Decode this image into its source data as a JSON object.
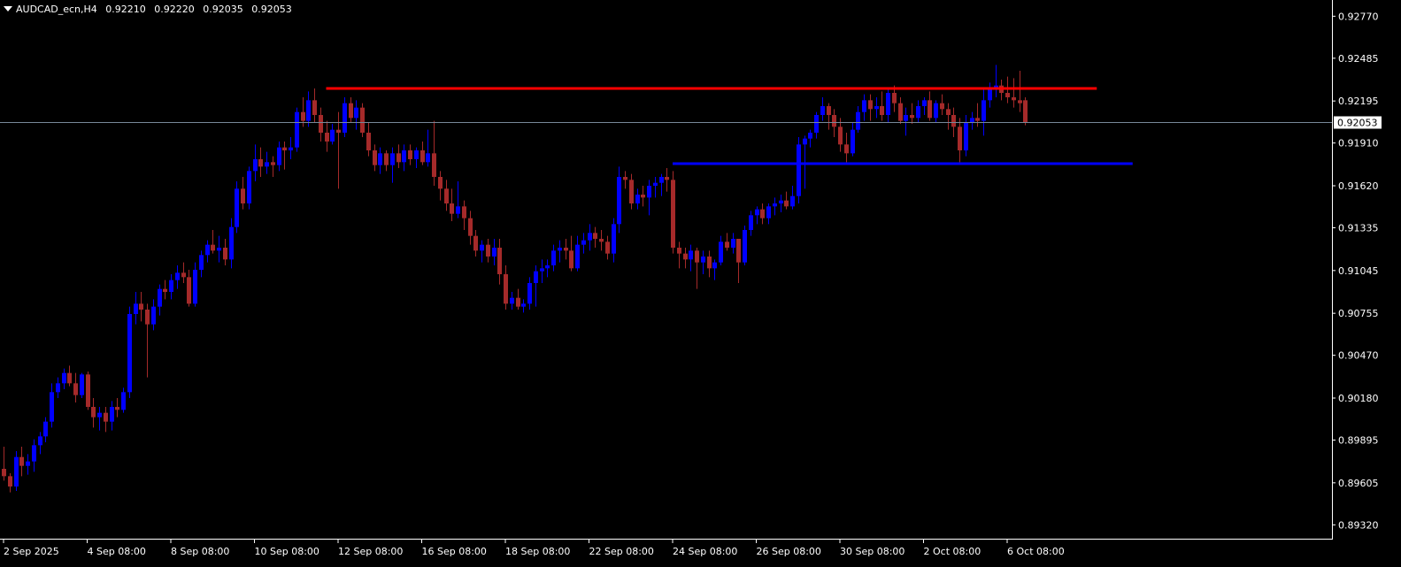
{
  "header": {
    "symbol_tf": "AUDCAD_ecn,H4",
    "ohlc": [
      "0.92210",
      "0.92220",
      "0.92035",
      "0.92053"
    ]
  },
  "colors": {
    "background": "#000000",
    "bull": "#0000ff",
    "bear": "#a52a2a",
    "resistance": "#ff0000",
    "support": "#0000ff",
    "bid_line": "#778899",
    "axis": "#ffffff"
  },
  "chart_data": {
    "type": "candlestick",
    "symbol": "AUDCAD_ecn",
    "timeframe": "H4",
    "ylim": [
      0.8922,
      0.9288
    ],
    "y_ticks": [
      "0.92770",
      "0.92485",
      "0.92195",
      "0.91910",
      "0.91620",
      "0.91335",
      "0.91045",
      "0.90755",
      "0.90470",
      "0.90180",
      "0.89895",
      "0.89605",
      "0.89320"
    ],
    "x_ticks": [
      {
        "label": "2 Sep 2025",
        "bar": 0
      },
      {
        "label": "4 Sep 08:00",
        "bar": 14
      },
      {
        "label": "8 Sep 08:00",
        "bar": 28
      },
      {
        "label": "10 Sep 08:00",
        "bar": 42
      },
      {
        "label": "12 Sep 08:00",
        "bar": 56
      },
      {
        "label": "16 Sep 08:00",
        "bar": 70
      },
      {
        "label": "18 Sep 08:00",
        "bar": 84
      },
      {
        "label": "22 Sep 08:00",
        "bar": 98
      },
      {
        "label": "24 Sep 08:00",
        "bar": 112
      },
      {
        "label": "26 Sep 08:00",
        "bar": 126
      },
      {
        "label": "30 Sep 08:00",
        "bar": 140
      },
      {
        "label": "2 Oct 08:00",
        "bar": 154
      },
      {
        "label": "6 Oct 08:00",
        "bar": 168
      }
    ],
    "current_price": "0.92053",
    "current_price_value": 0.92053,
    "levels": [
      {
        "kind": "resistance",
        "price": 0.9228,
        "from_bar": 54,
        "to_bar": 183
      },
      {
        "kind": "support",
        "price": 0.9177,
        "from_bar": 112,
        "to_bar": 189
      }
    ],
    "candles": [
      [
        0.897,
        0.8985,
        0.8962,
        0.8965
      ],
      [
        0.8965,
        0.8967,
        0.8954,
        0.8958
      ],
      [
        0.8958,
        0.8982,
        0.8955,
        0.8978
      ],
      [
        0.8978,
        0.8985,
        0.8965,
        0.8972
      ],
      [
        0.8972,
        0.898,
        0.8966,
        0.8975
      ],
      [
        0.8975,
        0.899,
        0.8968,
        0.8986
      ],
      [
        0.8986,
        0.8995,
        0.898,
        0.8992
      ],
      [
        0.8992,
        0.9005,
        0.8988,
        0.9002
      ],
      [
        0.9002,
        0.9028,
        0.8998,
        0.9022
      ],
      [
        0.9022,
        0.9032,
        0.9018,
        0.9028
      ],
      [
        0.9028,
        0.9038,
        0.9024,
        0.9035
      ],
      [
        0.9035,
        0.904,
        0.9026,
        0.9028
      ],
      [
        0.9028,
        0.9035,
        0.9015,
        0.902
      ],
      [
        0.902,
        0.9035,
        0.9018,
        0.9034
      ],
      [
        0.9034,
        0.9036,
        0.901,
        0.9012
      ],
      [
        0.9012,
        0.9018,
        0.8998,
        0.9005
      ],
      [
        0.9005,
        0.9012,
        0.8996,
        0.9008
      ],
      [
        0.9008,
        0.9012,
        0.8995,
        0.9002
      ],
      [
        0.9002,
        0.9016,
        0.8996,
        0.9012
      ],
      [
        0.9012,
        0.9018,
        0.9005,
        0.901
      ],
      [
        0.901,
        0.9025,
        0.9008,
        0.9022
      ],
      [
        0.9022,
        0.908,
        0.9018,
        0.9075
      ],
      [
        0.9075,
        0.909,
        0.9068,
        0.9082
      ],
      [
        0.9082,
        0.909,
        0.907,
        0.9078
      ],
      [
        0.9078,
        0.9082,
        0.9032,
        0.9068
      ],
      [
        0.9068,
        0.9085,
        0.9064,
        0.908
      ],
      [
        0.908,
        0.9095,
        0.9074,
        0.9092
      ],
      [
        0.9092,
        0.9098,
        0.9085,
        0.909
      ],
      [
        0.909,
        0.9102,
        0.9085,
        0.9098
      ],
      [
        0.9098,
        0.9108,
        0.9092,
        0.9103
      ],
      [
        0.9103,
        0.911,
        0.9096,
        0.91
      ],
      [
        0.91,
        0.9105,
        0.908,
        0.9082
      ],
      [
        0.9082,
        0.911,
        0.908,
        0.9105
      ],
      [
        0.9105,
        0.9118,
        0.91,
        0.9115
      ],
      [
        0.9115,
        0.9125,
        0.911,
        0.9122
      ],
      [
        0.9122,
        0.9132,
        0.9116,
        0.9118
      ],
      [
        0.9118,
        0.9128,
        0.911,
        0.912
      ],
      [
        0.912,
        0.9126,
        0.9108,
        0.9112
      ],
      [
        0.9112,
        0.914,
        0.9106,
        0.9134
      ],
      [
        0.9134,
        0.9165,
        0.913,
        0.916
      ],
      [
        0.916,
        0.9168,
        0.9146,
        0.915
      ],
      [
        0.915,
        0.9175,
        0.9146,
        0.9172
      ],
      [
        0.9172,
        0.919,
        0.9165,
        0.918
      ],
      [
        0.918,
        0.9188,
        0.9168,
        0.9175
      ],
      [
        0.9175,
        0.9185,
        0.917,
        0.9178
      ],
      [
        0.9178,
        0.9182,
        0.9168,
        0.9176
      ],
      [
        0.9176,
        0.9192,
        0.9172,
        0.9188
      ],
      [
        0.9188,
        0.9192,
        0.9173,
        0.9186
      ],
      [
        0.9186,
        0.9195,
        0.918,
        0.9188
      ],
      [
        0.9188,
        0.9215,
        0.9185,
        0.9212
      ],
      [
        0.9212,
        0.9222,
        0.9202,
        0.9206
      ],
      [
        0.9206,
        0.9226,
        0.9202,
        0.922
      ],
      [
        0.922,
        0.9228,
        0.9205,
        0.921
      ],
      [
        0.921,
        0.9215,
        0.9192,
        0.9198
      ],
      [
        0.9198,
        0.9206,
        0.9185,
        0.9192
      ],
      [
        0.9192,
        0.9204,
        0.919,
        0.92
      ],
      [
        0.92,
        0.9212,
        0.916,
        0.9198
      ],
      [
        0.9198,
        0.9222,
        0.9195,
        0.9218
      ],
      [
        0.9218,
        0.9222,
        0.9205,
        0.9208
      ],
      [
        0.9208,
        0.922,
        0.92,
        0.9215
      ],
      [
        0.9215,
        0.9218,
        0.9195,
        0.9198
      ],
      [
        0.9198,
        0.9205,
        0.9182,
        0.9186
      ],
      [
        0.9186,
        0.919,
        0.9172,
        0.9176
      ],
      [
        0.9176,
        0.9188,
        0.917,
        0.9184
      ],
      [
        0.9184,
        0.9186,
        0.9172,
        0.9176
      ],
      [
        0.9176,
        0.9188,
        0.9164,
        0.9184
      ],
      [
        0.9184,
        0.919,
        0.9174,
        0.9178
      ],
      [
        0.9178,
        0.919,
        0.9172,
        0.9186
      ],
      [
        0.9186,
        0.919,
        0.9176,
        0.918
      ],
      [
        0.918,
        0.9188,
        0.9174,
        0.9186
      ],
      [
        0.9186,
        0.9192,
        0.9176,
        0.9178
      ],
      [
        0.9178,
        0.92,
        0.9175,
        0.9184
      ],
      [
        0.9184,
        0.9206,
        0.9162,
        0.9168
      ],
      [
        0.9168,
        0.9172,
        0.9152,
        0.916
      ],
      [
        0.916,
        0.9166,
        0.9145,
        0.915
      ],
      [
        0.915,
        0.916,
        0.9138,
        0.9143
      ],
      [
        0.9143,
        0.9165,
        0.914,
        0.9148
      ],
      [
        0.9148,
        0.9152,
        0.9132,
        0.914
      ],
      [
        0.914,
        0.9145,
        0.9122,
        0.9128
      ],
      [
        0.9128,
        0.9132,
        0.9114,
        0.9118
      ],
      [
        0.9118,
        0.9125,
        0.911,
        0.9122
      ],
      [
        0.9122,
        0.9126,
        0.911,
        0.9114
      ],
      [
        0.9114,
        0.9126,
        0.9108,
        0.912
      ],
      [
        0.912,
        0.9126,
        0.9095,
        0.9102
      ],
      [
        0.9102,
        0.9108,
        0.9078,
        0.9082
      ],
      [
        0.9082,
        0.909,
        0.9078,
        0.9086
      ],
      [
        0.9086,
        0.9092,
        0.9078,
        0.908
      ],
      [
        0.908,
        0.9085,
        0.9076,
        0.9082
      ],
      [
        0.9082,
        0.91,
        0.9078,
        0.9096
      ],
      [
        0.9096,
        0.9108,
        0.908,
        0.9104
      ],
      [
        0.9104,
        0.9112,
        0.9096,
        0.9106
      ],
      [
        0.9106,
        0.9112,
        0.91,
        0.9108
      ],
      [
        0.9108,
        0.9122,
        0.9104,
        0.9118
      ],
      [
        0.9118,
        0.9125,
        0.911,
        0.912
      ],
      [
        0.912,
        0.9126,
        0.9112,
        0.9118
      ],
      [
        0.9118,
        0.9128,
        0.9104,
        0.9106
      ],
      [
        0.9106,
        0.9128,
        0.9104,
        0.9122
      ],
      [
        0.9122,
        0.913,
        0.9116,
        0.9125
      ],
      [
        0.9125,
        0.9136,
        0.9118,
        0.913
      ],
      [
        0.913,
        0.9134,
        0.912,
        0.9126
      ],
      [
        0.9126,
        0.9132,
        0.9118,
        0.9124
      ],
      [
        0.9124,
        0.9128,
        0.9112,
        0.9116
      ],
      [
        0.9116,
        0.914,
        0.911,
        0.9136
      ],
      [
        0.9136,
        0.9175,
        0.913,
        0.9168
      ],
      [
        0.9168,
        0.9172,
        0.916,
        0.9166
      ],
      [
        0.9166,
        0.917,
        0.9146,
        0.915
      ],
      [
        0.915,
        0.916,
        0.9146,
        0.9156
      ],
      [
        0.9156,
        0.9162,
        0.9148,
        0.9154
      ],
      [
        0.9154,
        0.9166,
        0.9142,
        0.9162
      ],
      [
        0.9162,
        0.9168,
        0.9154,
        0.9164
      ],
      [
        0.9164,
        0.917,
        0.9155,
        0.9168
      ],
      [
        0.9168,
        0.9174,
        0.9158,
        0.9166
      ],
      [
        0.9166,
        0.9172,
        0.9116,
        0.912
      ],
      [
        0.912,
        0.9124,
        0.9106,
        0.9116
      ],
      [
        0.9116,
        0.912,
        0.9106,
        0.9112
      ],
      [
        0.9112,
        0.9122,
        0.9104,
        0.9118
      ],
      [
        0.9118,
        0.912,
        0.9092,
        0.911
      ],
      [
        0.911,
        0.9118,
        0.9102,
        0.9114
      ],
      [
        0.9114,
        0.9118,
        0.91,
        0.9106
      ],
      [
        0.9106,
        0.9112,
        0.9098,
        0.911
      ],
      [
        0.911,
        0.9128,
        0.9108,
        0.9124
      ],
      [
        0.9124,
        0.913,
        0.9118,
        0.912
      ],
      [
        0.912,
        0.913,
        0.9116,
        0.9126
      ],
      [
        0.9126,
        0.9124,
        0.9096,
        0.911
      ],
      [
        0.911,
        0.9135,
        0.9108,
        0.9132
      ],
      [
        0.9132,
        0.9145,
        0.9128,
        0.9142
      ],
      [
        0.9142,
        0.9148,
        0.9136,
        0.9146
      ],
      [
        0.9146,
        0.915,
        0.9136,
        0.914
      ],
      [
        0.914,
        0.915,
        0.9136,
        0.9148
      ],
      [
        0.9148,
        0.9154,
        0.9142,
        0.915
      ],
      [
        0.915,
        0.9156,
        0.9144,
        0.9152
      ],
      [
        0.9152,
        0.9158,
        0.9146,
        0.9148
      ],
      [
        0.9148,
        0.9162,
        0.9146,
        0.9155
      ],
      [
        0.9155,
        0.9195,
        0.915,
        0.919
      ],
      [
        0.919,
        0.9196,
        0.916,
        0.9194
      ],
      [
        0.9194,
        0.92,
        0.9188,
        0.9198
      ],
      [
        0.9198,
        0.9212,
        0.9194,
        0.921
      ],
      [
        0.921,
        0.9222,
        0.9206,
        0.9216
      ],
      [
        0.9216,
        0.9218,
        0.92,
        0.921
      ],
      [
        0.921,
        0.9214,
        0.9195,
        0.9202
      ],
      [
        0.9202,
        0.9208,
        0.9185,
        0.919
      ],
      [
        0.919,
        0.9198,
        0.9178,
        0.9184
      ],
      [
        0.9184,
        0.9205,
        0.9182,
        0.92
      ],
      [
        0.92,
        0.9216,
        0.9198,
        0.9212
      ],
      [
        0.9212,
        0.9224,
        0.9206,
        0.922
      ],
      [
        0.922,
        0.9224,
        0.9206,
        0.9214
      ],
      [
        0.9214,
        0.9222,
        0.9208,
        0.9216
      ],
      [
        0.9216,
        0.9226,
        0.9206,
        0.921
      ],
      [
        0.921,
        0.9228,
        0.9205,
        0.9225
      ],
      [
        0.9225,
        0.923,
        0.9212,
        0.9218
      ],
      [
        0.9218,
        0.9222,
        0.9204,
        0.9206
      ],
      [
        0.9206,
        0.9215,
        0.9196,
        0.921
      ],
      [
        0.921,
        0.9218,
        0.9204,
        0.9208
      ],
      [
        0.9208,
        0.922,
        0.9205,
        0.9216
      ],
      [
        0.9216,
        0.9222,
        0.921,
        0.922
      ],
      [
        0.922,
        0.9226,
        0.9206,
        0.9208
      ],
      [
        0.9208,
        0.922,
        0.9205,
        0.9218
      ],
      [
        0.9218,
        0.9224,
        0.921,
        0.9214
      ],
      [
        0.9214,
        0.9218,
        0.92,
        0.921
      ],
      [
        0.921,
        0.9215,
        0.9195,
        0.9202
      ],
      [
        0.9202,
        0.9208,
        0.9178,
        0.9186
      ],
      [
        0.9186,
        0.921,
        0.9182,
        0.9205
      ],
      [
        0.9205,
        0.9212,
        0.92,
        0.9208
      ],
      [
        0.9208,
        0.9218,
        0.9202,
        0.9206
      ],
      [
        0.9206,
        0.9228,
        0.9196,
        0.922
      ],
      [
        0.922,
        0.9232,
        0.9215,
        0.9228
      ],
      [
        0.9228,
        0.9244,
        0.9222,
        0.923
      ],
      [
        0.923,
        0.9234,
        0.922,
        0.9225
      ],
      [
        0.9225,
        0.9236,
        0.9218,
        0.9222
      ],
      [
        0.9222,
        0.9235,
        0.9215,
        0.922
      ],
      [
        0.922,
        0.924,
        0.9212,
        0.9218
      ],
      [
        0.922,
        0.9222,
        0.9203,
        0.9205
      ]
    ]
  }
}
